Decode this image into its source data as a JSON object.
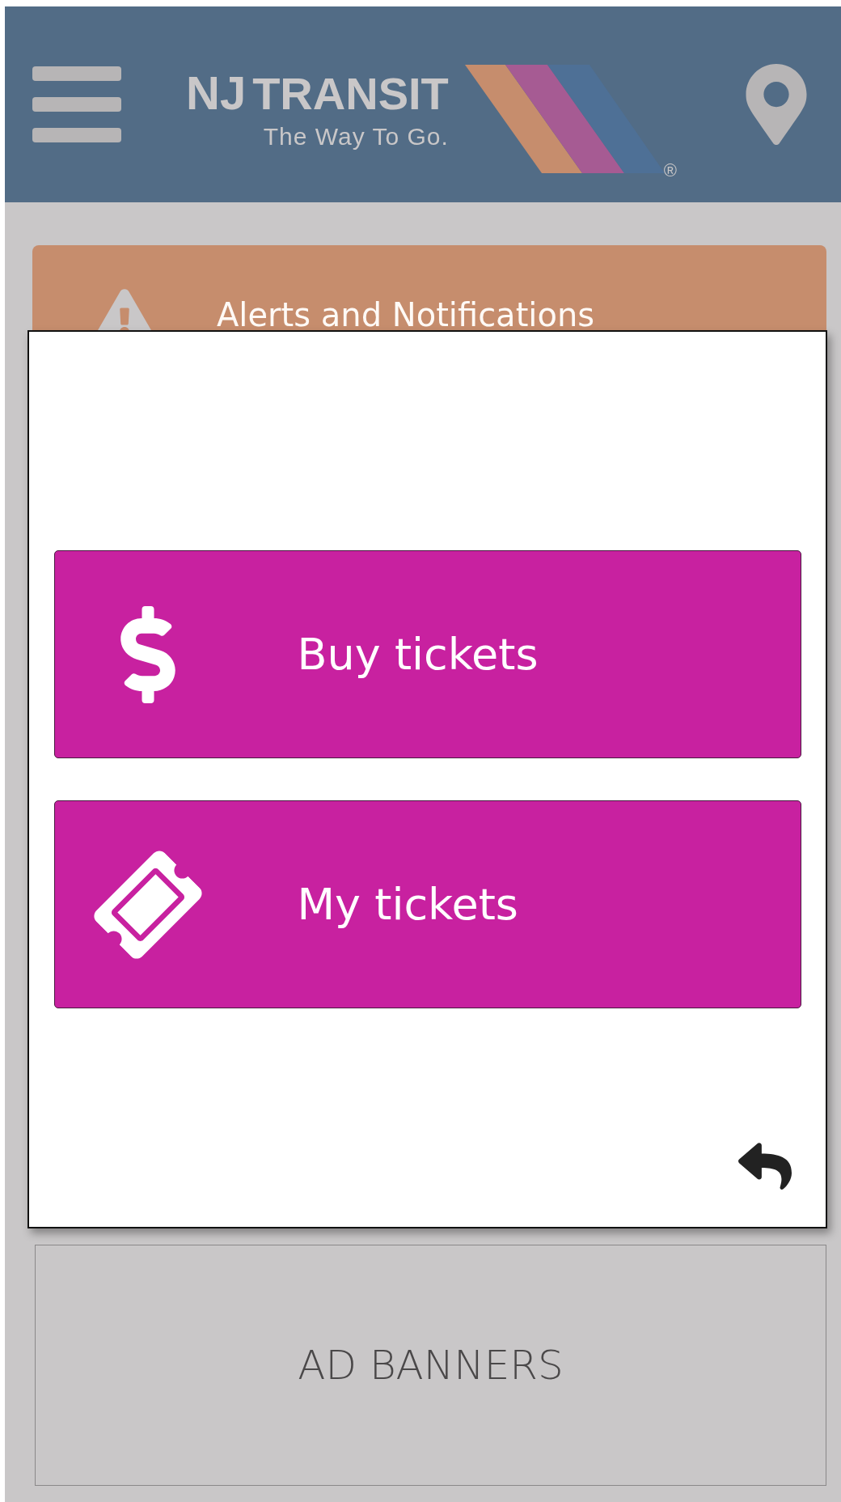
{
  "header": {
    "logo": {
      "monogram": "NJ",
      "name": "TRANSIT",
      "tagline": "The Way To Go.",
      "registered": "®"
    }
  },
  "alert_bar": {
    "label": "Alerts and Notifications"
  },
  "dialog": {
    "actions": [
      {
        "kind": "buy",
        "label": "Buy tickets"
      },
      {
        "kind": "tickets",
        "label": "My tickets"
      }
    ]
  },
  "ad_banner": {
    "label": "AD BANNERS"
  }
}
